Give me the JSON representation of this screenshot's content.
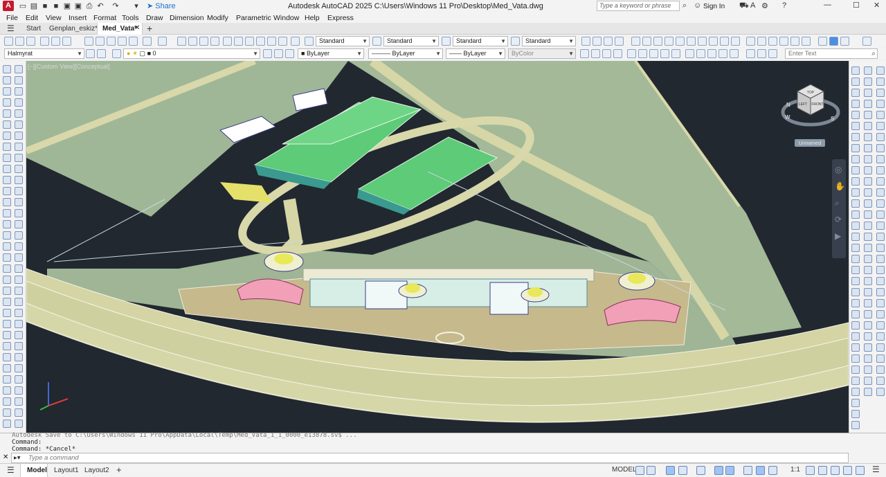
{
  "titlebar": {
    "app_logo": "A",
    "share": "Share",
    "title": "Autodesk AutoCAD 2025   C:\\Users\\Windows 11 Pro\\Desktop\\Med_Vata.dwg",
    "search_placeholder": "Type a keyword or phrase",
    "signin": "Sign In"
  },
  "menu": [
    "File",
    "Edit",
    "View",
    "Insert",
    "Format",
    "Tools",
    "Draw",
    "Dimension",
    "Modify",
    "Parametric",
    "Window",
    "Help",
    "Express"
  ],
  "tabs": {
    "start": "Start",
    "file1": "Genplan_eskiz*",
    "file2": "Med_Vata*",
    "add": "+"
  },
  "toolbar1": {
    "text_style": "Standard",
    "dim_style": "Standard",
    "table_style": "Standard",
    "mleader_style": "Standard"
  },
  "toolbar2": {
    "layer": "Halmyrat",
    "layer_num": "0",
    "color": "ByLayer",
    "linetype": "ByLayer",
    "lineweight": "ByLayer",
    "plotstyle": "ByColor",
    "enter_text_placeholder": "Enter Text"
  },
  "viewport": {
    "label": "[−][Custom View][Conceptual]",
    "view_name": "Unnamed",
    "viewcube": {
      "top": "TOP",
      "left": "LEFT",
      "front": "FRONT",
      "n": "N",
      "w": "W",
      "s": "S"
    }
  },
  "command": {
    "history1": "Autodesk Save to C:\\Users\\Windows 11 Pro\\AppData\\Local\\Temp\\Med_Vata_1_1_0000_e13878.sv$ ...",
    "history2": "Command:",
    "history3": "Command: *Cancel*",
    "input_placeholder": "Type a command"
  },
  "layouts": {
    "model": "Model",
    "layout1": "Layout1",
    "layout2": "Layout2",
    "add": "+"
  },
  "status": {
    "model": "MODEL",
    "scale": "1:1"
  },
  "colors": {
    "viewport_bg": "#212830",
    "ground": "#a2b898",
    "road": "#d8d8a8",
    "roof_green": "#5ecb79",
    "accent": "#c5192d"
  }
}
